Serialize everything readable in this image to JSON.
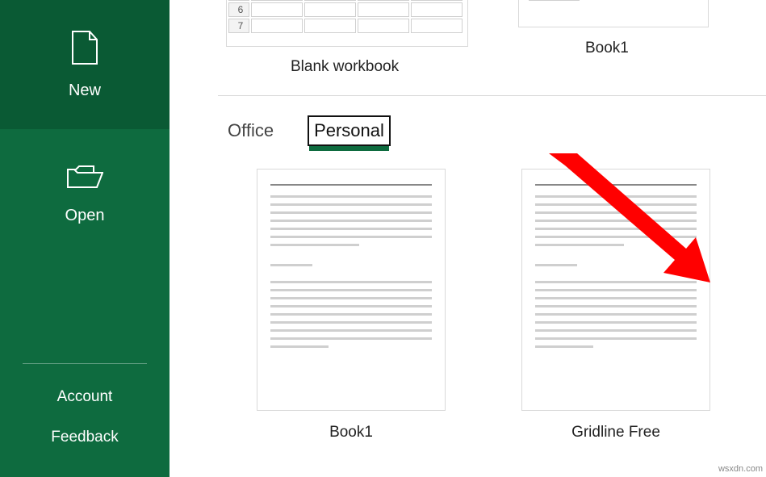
{
  "sidebar": {
    "new": "New",
    "open": "Open",
    "account": "Account",
    "feedback": "Feedback"
  },
  "topRow": {
    "blankLabel": "Blank workbook",
    "book1Label": "Book1",
    "rows": [
      "6",
      "7"
    ]
  },
  "tabs": {
    "office": "Office",
    "personal": "Personal"
  },
  "templates": [
    {
      "label": "Book1"
    },
    {
      "label": "Gridline Free"
    }
  ],
  "watermark": "wsxdn.com"
}
